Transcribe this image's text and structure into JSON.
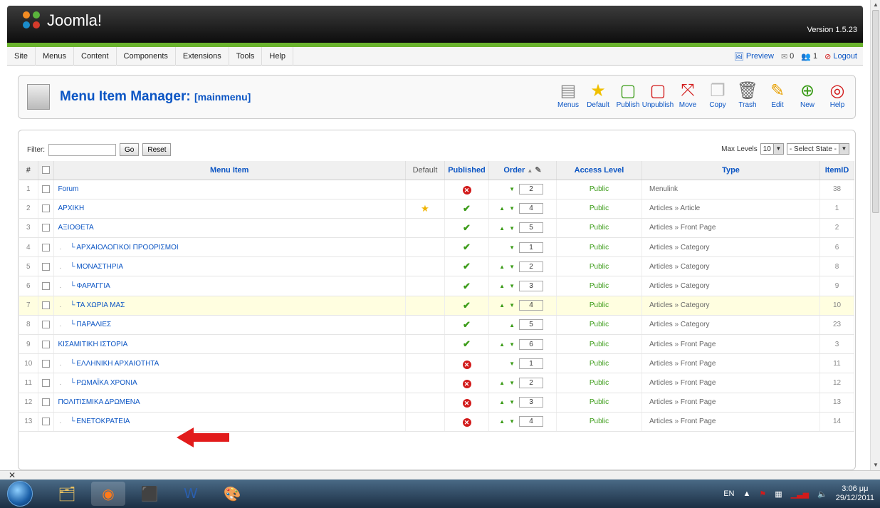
{
  "header": {
    "brand": "Joomla!",
    "version": "Version 1.5.23"
  },
  "menubar": {
    "items": [
      "Site",
      "Menus",
      "Content",
      "Components",
      "Extensions",
      "Tools",
      "Help"
    ],
    "preview": "Preview",
    "messages_count": "0",
    "users_count": "1",
    "logout": "Logout"
  },
  "toolbar": {
    "title": "Menu Item Manager:",
    "subtitle": "[mainmenu]",
    "buttons": [
      "Menus",
      "Default",
      "Publish",
      "Unpublish",
      "Move",
      "Copy",
      "Trash",
      "Edit",
      "New",
      "Help"
    ]
  },
  "filter": {
    "label": "Filter:",
    "value": "",
    "go": "Go",
    "reset": "Reset"
  },
  "levels": {
    "label": "Max Levels",
    "value": "10",
    "state": "- Select State -"
  },
  "table": {
    "headers": {
      "num": "#",
      "name": "Menu Item",
      "default": "Default",
      "published": "Published",
      "order": "Order",
      "access": "Access Level",
      "type": "Type",
      "itemid": "ItemID"
    },
    "rows": [
      {
        "num": "1",
        "name": "Forum",
        "child": false,
        "default": false,
        "published": false,
        "up": false,
        "down": true,
        "order": "2",
        "access": "Public",
        "type": "Menulink",
        "itemid": "38"
      },
      {
        "num": "2",
        "name": "ΑΡΧΙΚΗ",
        "child": false,
        "default": true,
        "published": true,
        "up": true,
        "down": true,
        "order": "4",
        "access": "Public",
        "type": "Articles » Article",
        "itemid": "1"
      },
      {
        "num": "3",
        "name": "ΑΞΙΟΘΕΤΑ",
        "child": false,
        "default": false,
        "published": true,
        "up": true,
        "down": true,
        "order": "5",
        "access": "Public",
        "type": "Articles » Front Page",
        "itemid": "2"
      },
      {
        "num": "4",
        "name": "ΑΡΧΑΙΟΛΟΓΙΚΟΙ ΠΡΟΟΡΙΣΜΟΙ",
        "child": true,
        "default": false,
        "published": true,
        "up": false,
        "down": true,
        "order": "1",
        "access": "Public",
        "type": "Articles » Category",
        "itemid": "6"
      },
      {
        "num": "5",
        "name": "ΜΟΝΑΣΤΗΡΙΑ",
        "child": true,
        "default": false,
        "published": true,
        "up": true,
        "down": true,
        "order": "2",
        "access": "Public",
        "type": "Articles » Category",
        "itemid": "8"
      },
      {
        "num": "6",
        "name": "ΦΑΡΑΓΓΙΑ",
        "child": true,
        "default": false,
        "published": true,
        "up": true,
        "down": true,
        "order": "3",
        "access": "Public",
        "type": "Articles » Category",
        "itemid": "9"
      },
      {
        "num": "7",
        "name": "ΤΑ ΧΩΡΙΑ ΜΑΣ",
        "child": true,
        "default": false,
        "published": true,
        "up": true,
        "down": true,
        "order": "4",
        "access": "Public",
        "type": "Articles » Category",
        "itemid": "10",
        "highlight": true
      },
      {
        "num": "8",
        "name": "ΠΑΡΑΛΙΕΣ",
        "child": true,
        "default": false,
        "published": true,
        "up": true,
        "down": false,
        "order": "5",
        "access": "Public",
        "type": "Articles » Category",
        "itemid": "23"
      },
      {
        "num": "9",
        "name": "ΚΙΣΑΜΙΤΙΚΗ ΙΣΤΟΡΙΑ",
        "child": false,
        "default": false,
        "published": true,
        "up": true,
        "down": true,
        "order": "6",
        "access": "Public",
        "type": "Articles » Front Page",
        "itemid": "3"
      },
      {
        "num": "10",
        "name": "ΕΛΛΗΝΙΚΗ ΑΡΧΑΙΟΤΗΤΑ",
        "child": true,
        "default": false,
        "published": false,
        "up": false,
        "down": true,
        "order": "1",
        "access": "Public",
        "type": "Articles » Front Page",
        "itemid": "11"
      },
      {
        "num": "11",
        "name": "ΡΩΜΑΪΚΑ ΧΡΟΝΙΑ",
        "child": true,
        "default": false,
        "published": false,
        "up": true,
        "down": true,
        "order": "2",
        "access": "Public",
        "type": "Articles » Front Page",
        "itemid": "12"
      },
      {
        "num": "12",
        "name": "ΠΟΛΙΤΙΣΜΙΚΑ ΔΡΩΜΕΝΑ",
        "child": false,
        "default": false,
        "published": false,
        "up": true,
        "down": true,
        "order": "3",
        "access": "Public",
        "type": "Articles » Front Page",
        "itemid": "13"
      },
      {
        "num": "13",
        "name": "ΕΝΕΤΟΚΡΑΤΕΙΑ",
        "child": true,
        "default": false,
        "published": false,
        "up": true,
        "down": true,
        "order": "4",
        "access": "Public",
        "type": "Articles » Front Page",
        "itemid": "14"
      }
    ]
  },
  "taskbar": {
    "lang": "EN",
    "time": "3:06 μμ",
    "date": "29/12/2011"
  }
}
